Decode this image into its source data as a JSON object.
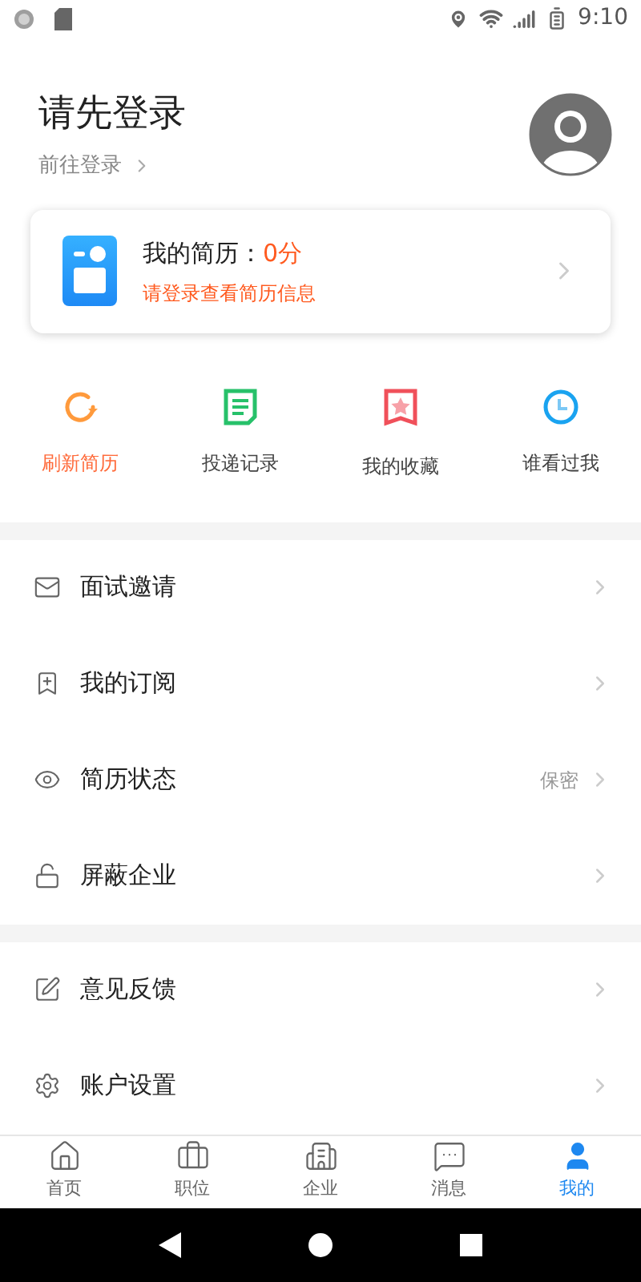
{
  "status_bar": {
    "time": "9:10"
  },
  "header": {
    "title": "请先登录",
    "link": "前往登录"
  },
  "resume_card": {
    "label": "我的简历：",
    "score": "0分",
    "hint": "请登录查看简历信息"
  },
  "quick_actions": [
    {
      "kind": "refresh",
      "label": "刷新简历",
      "selected": true
    },
    {
      "kind": "record",
      "label": "投递记录",
      "selected": false
    },
    {
      "kind": "favorite",
      "label": "我的收藏",
      "selected": false
    },
    {
      "kind": "viewer",
      "label": "谁看过我",
      "selected": false
    }
  ],
  "menu_groups": [
    [
      {
        "kind": "mail",
        "label": "面试邀请"
      },
      {
        "kind": "bookmark",
        "label": "我的订阅"
      },
      {
        "kind": "eye",
        "label": "简历状态",
        "value": "保密"
      },
      {
        "kind": "lock",
        "label": "屏蔽企业"
      }
    ],
    [
      {
        "kind": "edit",
        "label": "意见反馈"
      },
      {
        "kind": "gear",
        "label": "账户设置"
      }
    ]
  ],
  "tab_bar": [
    {
      "kind": "home",
      "label": "首页",
      "selected": false
    },
    {
      "kind": "job",
      "label": "职位",
      "selected": false
    },
    {
      "kind": "company",
      "label": "企业",
      "selected": false
    },
    {
      "kind": "message",
      "label": "消息",
      "selected": false
    },
    {
      "kind": "me",
      "label": "我的",
      "selected": true
    }
  ]
}
